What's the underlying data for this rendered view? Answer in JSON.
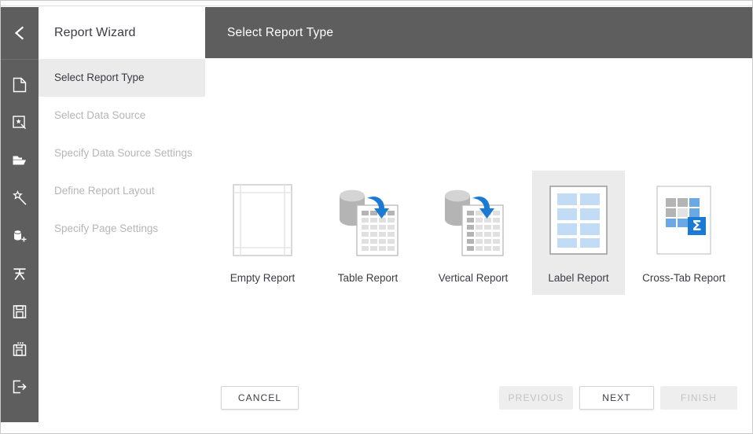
{
  "window": {
    "accent_blue": "#1a7ad4",
    "rail_bg": "#5e5e5e",
    "selected_bg": "#ebebeb"
  },
  "rail": {
    "back_icon": "chevron-left-icon",
    "items": [
      {
        "icon": "new-report-page-icon",
        "name": "rail-item-new-report"
      },
      {
        "icon": "report-wizard-icon",
        "name": "rail-item-report-wizard"
      },
      {
        "icon": "open-folder-icon",
        "name": "rail-item-open"
      },
      {
        "icon": "magic-wand-icon",
        "name": "rail-item-wizard"
      },
      {
        "icon": "add-data-source-icon",
        "name": "rail-item-add-data-source"
      },
      {
        "icon": "localization-icon",
        "name": "rail-item-localization"
      },
      {
        "icon": "save-icon",
        "name": "rail-item-save"
      },
      {
        "icon": "save-as-icon",
        "name": "rail-item-save-as"
      },
      {
        "icon": "exit-icon",
        "name": "rail-item-exit"
      }
    ]
  },
  "wizard": {
    "title": "Report Wizard",
    "steps": [
      {
        "label": "Select Report Type",
        "active": true
      },
      {
        "label": "Select Data Source",
        "active": false
      },
      {
        "label": "Specify Data Source Settings",
        "active": false
      },
      {
        "label": "Define Report Layout",
        "active": false
      },
      {
        "label": "Specify Page Settings",
        "active": false
      }
    ]
  },
  "main": {
    "header_title": "Select Report Type",
    "report_types": [
      {
        "label": "Empty Report",
        "art": "empty-report-icon",
        "selected": false
      },
      {
        "label": "Table Report",
        "art": "table-report-icon",
        "selected": false
      },
      {
        "label": "Vertical Report",
        "art": "vertical-report-icon",
        "selected": false
      },
      {
        "label": "Label Report",
        "art": "label-report-icon",
        "selected": true
      },
      {
        "label": "Cross-Tab Report",
        "art": "cross-tab-report-icon",
        "selected": false
      }
    ],
    "buttons": {
      "cancel": {
        "label": "CANCEL",
        "disabled": false
      },
      "previous": {
        "label": "PREVIOUS",
        "disabled": true
      },
      "next": {
        "label": "NEXT",
        "disabled": false
      },
      "finish": {
        "label": "FINISH",
        "disabled": true
      }
    }
  }
}
